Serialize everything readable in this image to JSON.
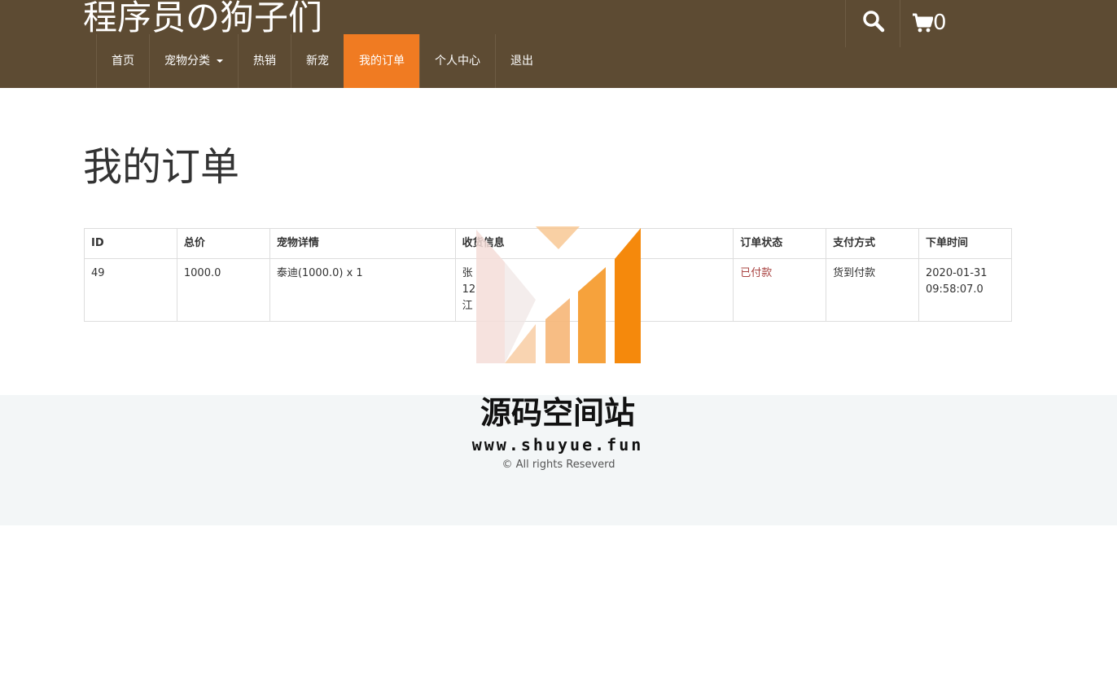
{
  "brand": "程序员の狗子们",
  "nav": [
    {
      "label": "首页"
    },
    {
      "label": "宠物分类"
    },
    {
      "label": "热销"
    },
    {
      "label": "新宠"
    },
    {
      "label": "我的订单",
      "active": true
    },
    {
      "label": "个人中心"
    },
    {
      "label": "退出"
    }
  ],
  "cart": {
    "count": "0"
  },
  "page_title": "我的订单",
  "table": {
    "headers": [
      "ID",
      "总价",
      "宠物详情",
      "收货信息",
      "订单状态",
      "支付方式",
      "下单时间"
    ],
    "rows": [
      {
        "id": "49",
        "total": "1000.0",
        "details": "泰迪(1000.0) x 1",
        "recipient_line1": "张",
        "recipient_line2": "12",
        "recipient_line3": "江",
        "status": "已付款",
        "payment": "货到付款",
        "time_line1": "2020-01-31",
        "time_line2": "09:58:07.0"
      }
    ]
  },
  "footer": {
    "copyright": "© All rights Reseverd"
  },
  "watermark": {
    "title": "源码空间站",
    "url": "www.shuyue.fun"
  },
  "colors": {
    "header_bg": "#5d4b33",
    "active_tab": "#f07b22",
    "status_paid": "#a94442",
    "footer_bg": "#f3f6f7"
  }
}
